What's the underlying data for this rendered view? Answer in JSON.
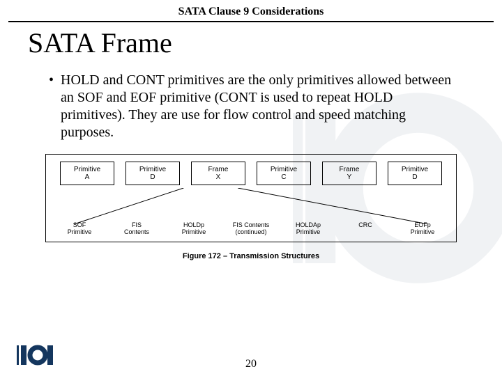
{
  "header": {
    "title": "SATA Clause 9 Considerations"
  },
  "slide": {
    "title": "SATA Frame"
  },
  "bullet": {
    "text": "HOLD and CONT primitives are the only primitives allowed between an SOF and EOF primitive (CONT is used to repeat HOLD primitives).  They are use for flow control and speed matching purposes."
  },
  "figure": {
    "top_boxes": [
      {
        "l1": "Primitive",
        "l2": "A"
      },
      {
        "l1": "Primitive",
        "l2": "D"
      },
      {
        "l1": "Frame",
        "l2": "X"
      },
      {
        "l1": "Primitive",
        "l2": "C"
      },
      {
        "l1": "Frame",
        "l2": "Y"
      },
      {
        "l1": "Primitive",
        "l2": "D"
      }
    ],
    "bottom_labels": [
      {
        "l1": "SOF",
        "l2": "Primitive"
      },
      {
        "l1": "FIS",
        "l2": "Contents"
      },
      {
        "l1": "HOLDp",
        "l2": "Primitive"
      },
      {
        "l1": "FIS Contents",
        "l2": "(continued)"
      },
      {
        "l1": "HOLDAp",
        "l2": "Primitive"
      },
      {
        "l1": "CRC",
        "l2": ""
      },
      {
        "l1": "EOFp",
        "l2": "Primitive"
      }
    ],
    "caption": "Figure 172 – Transmission Structures"
  },
  "footer": {
    "page": "20"
  }
}
